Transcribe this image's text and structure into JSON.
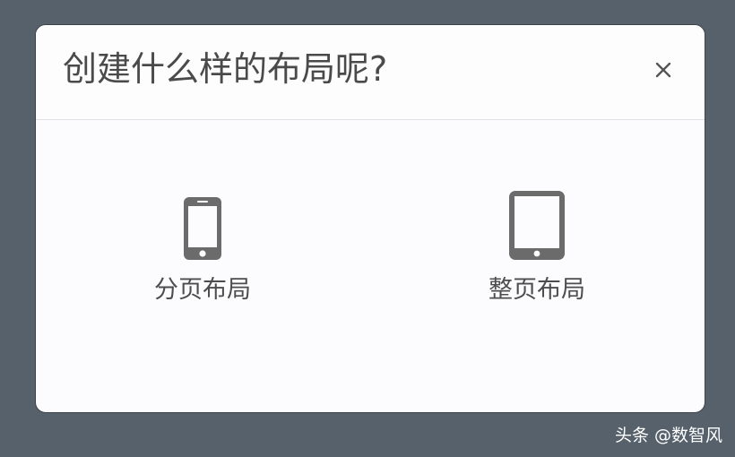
{
  "dialog": {
    "title": "创建什么样的布局呢?",
    "close_icon": "close-icon",
    "options": [
      {
        "label": "分页布局",
        "icon": "phone-icon"
      },
      {
        "label": "整页布局",
        "icon": "tablet-icon"
      }
    ]
  },
  "watermark": {
    "text": "头条 @数智风"
  },
  "colors": {
    "backdrop": "#56616b",
    "dialog_bg": "#fcfbfd",
    "icon": "#6b6b6b",
    "title_text": "#4a4a4a"
  }
}
